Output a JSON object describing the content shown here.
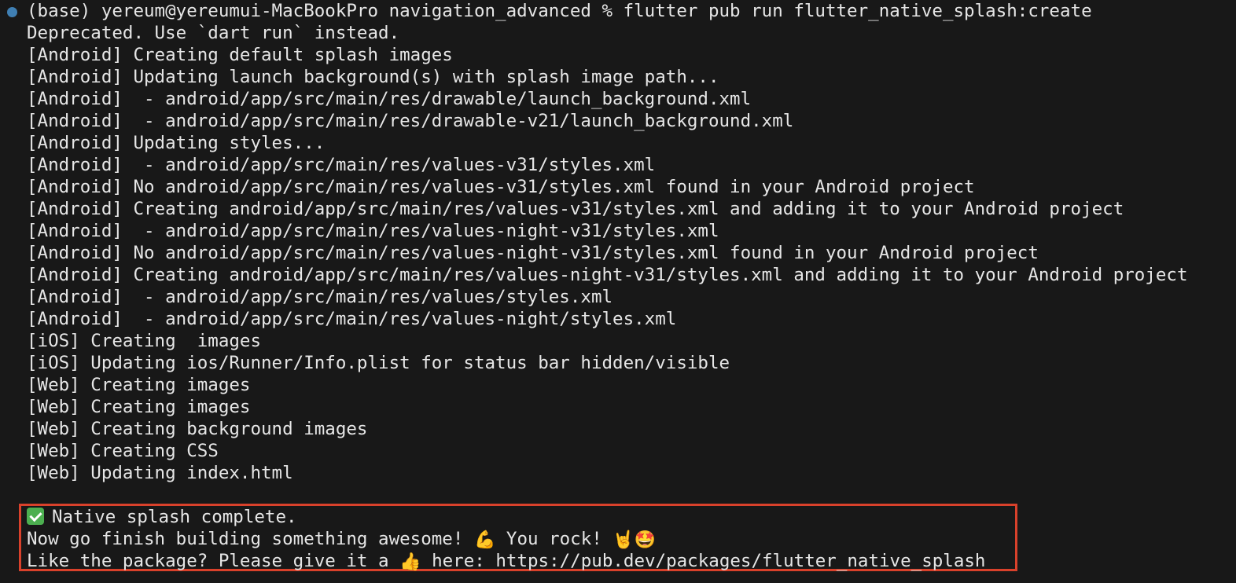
{
  "terminal": {
    "prompt_line": "(base) yereum@yereumui-MacBookPro navigation_advanced % flutter pub run flutter_native_splash:create",
    "output": [
      "Deprecated. Use `dart run` instead.",
      "[Android] Creating default splash images",
      "[Android] Updating launch background(s) with splash image path...",
      "[Android]  - android/app/src/main/res/drawable/launch_background.xml",
      "[Android]  - android/app/src/main/res/drawable-v21/launch_background.xml",
      "[Android] Updating styles...",
      "[Android]  - android/app/src/main/res/values-v31/styles.xml",
      "[Android] No android/app/src/main/res/values-v31/styles.xml found in your Android project",
      "[Android] Creating android/app/src/main/res/values-v31/styles.xml and adding it to your Android project",
      "[Android]  - android/app/src/main/res/values-night-v31/styles.xml",
      "[Android] No android/app/src/main/res/values-night-v31/styles.xml found in your Android project",
      "[Android] Creating android/app/src/main/res/values-night-v31/styles.xml and adding it to your Android project",
      "[Android]  - android/app/src/main/res/values/styles.xml",
      "[Android]  - android/app/src/main/res/values-night/styles.xml",
      "[iOS] Creating  images",
      "[iOS] Updating ios/Runner/Info.plist for status bar hidden/visible",
      "[Web] Creating images",
      "[Web] Creating images",
      "[Web] Creating background images",
      "[Web] Creating CSS",
      "[Web] Updating index.html"
    ],
    "messages": {
      "complete": "Native splash complete.",
      "go_finish": "Now go finish building something awesome! ",
      "muscle_emoji": "💪",
      "you_rock": " You rock! ",
      "rock_emoji": "🤘",
      "star_face_emoji": "🤩",
      "like_prefix": "Like the package? Please give it a ",
      "thumbs_up_emoji": "👍",
      "like_suffix": " here: https://pub.dev/packages/flutter_native_splash"
    }
  },
  "colors": {
    "background": "#181818",
    "text": "#e6e6e6",
    "prompt_dot": "#3f7fb3",
    "highlight_border": "#d9412b",
    "check_green": "#4caf50"
  }
}
